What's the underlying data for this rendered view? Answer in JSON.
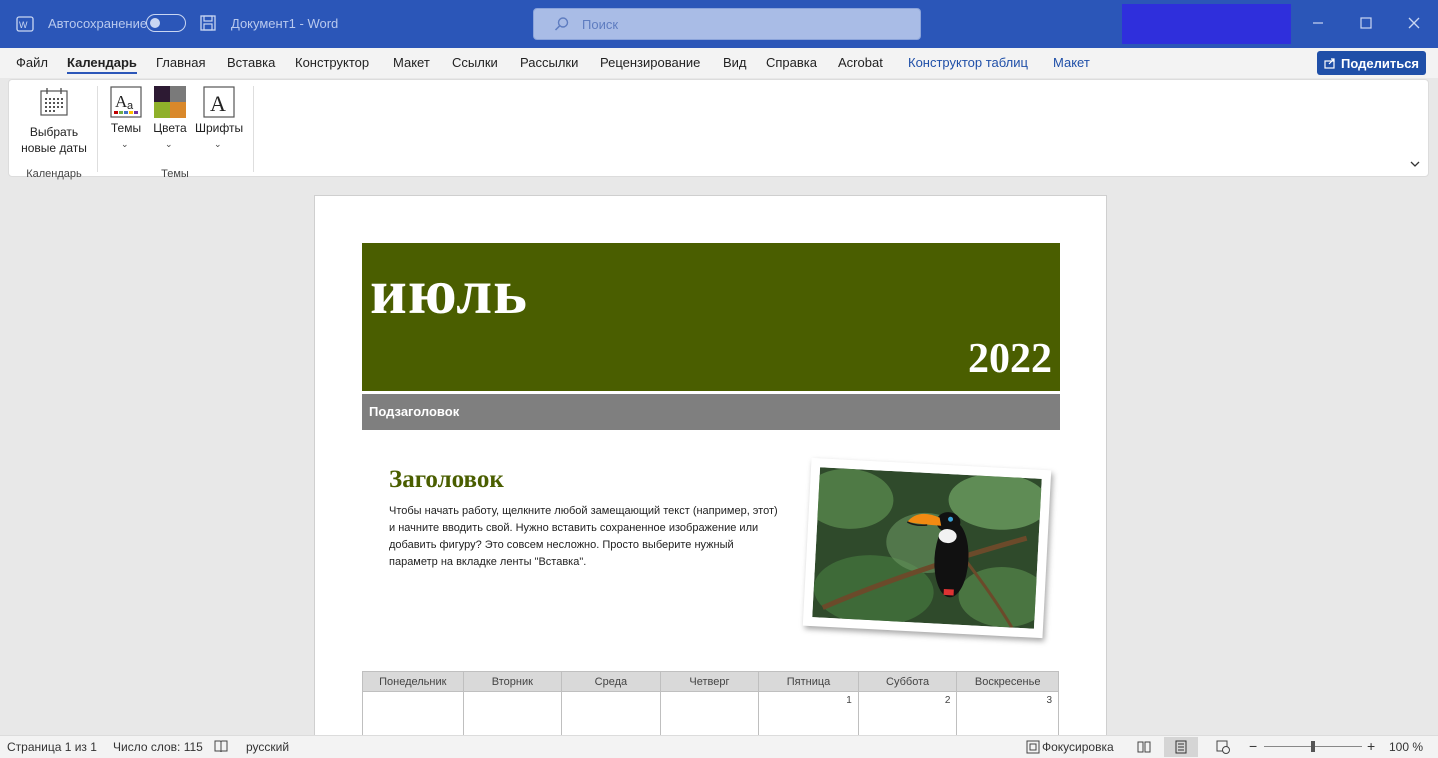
{
  "titlebar": {
    "autosave_label": "Автосохранение",
    "document_title": "Документ1  -  Word",
    "search_placeholder": "Поиск",
    "account_color": "#2f2fdc"
  },
  "menu": {
    "items": [
      "Файл",
      "Календарь",
      "Главная",
      "Вставка",
      "Конструктор",
      "Макет",
      "Ссылки",
      "Рассылки",
      "Рецензирование",
      "Вид",
      "Справка",
      "Acrobat",
      "Конструктор таблиц",
      "Макет"
    ],
    "active": "Календарь",
    "share_label": "Поделиться"
  },
  "ribbon": {
    "select_dates_line1": "Выбрать",
    "select_dates_line2": "новые даты",
    "themes_label": "Темы",
    "colors_label": "Цвета",
    "fonts_label": "Шрифты",
    "group_calendar": "Календарь",
    "group_themes": "Темы"
  },
  "document": {
    "month": "июль",
    "year": "2022",
    "subtitle": "Подзаголовок",
    "heading": "Заголовок",
    "body": "Чтобы начать работу, щелкните любой замещающий текст (например, этот) и начните вводить свой. Нужно вставить сохраненное изображение или добавить фигуру? Это совсем несложно. Просто выберите нужный параметр на вкладке ленты \"Вставка\".",
    "accent_color": "#4a5e00",
    "calendar": {
      "days": [
        "Понедельник",
        "Вторник",
        "Среда",
        "Четверг",
        "Пятница",
        "Суббота",
        "Воскресенье"
      ],
      "first_row": [
        "",
        "",
        "",
        "",
        "1",
        "2",
        "3"
      ]
    }
  },
  "statusbar": {
    "page": "Страница 1 из 1",
    "words": "Число слов: 115",
    "language": "русский",
    "focus": "Фокусировка",
    "zoom": "100 %"
  }
}
